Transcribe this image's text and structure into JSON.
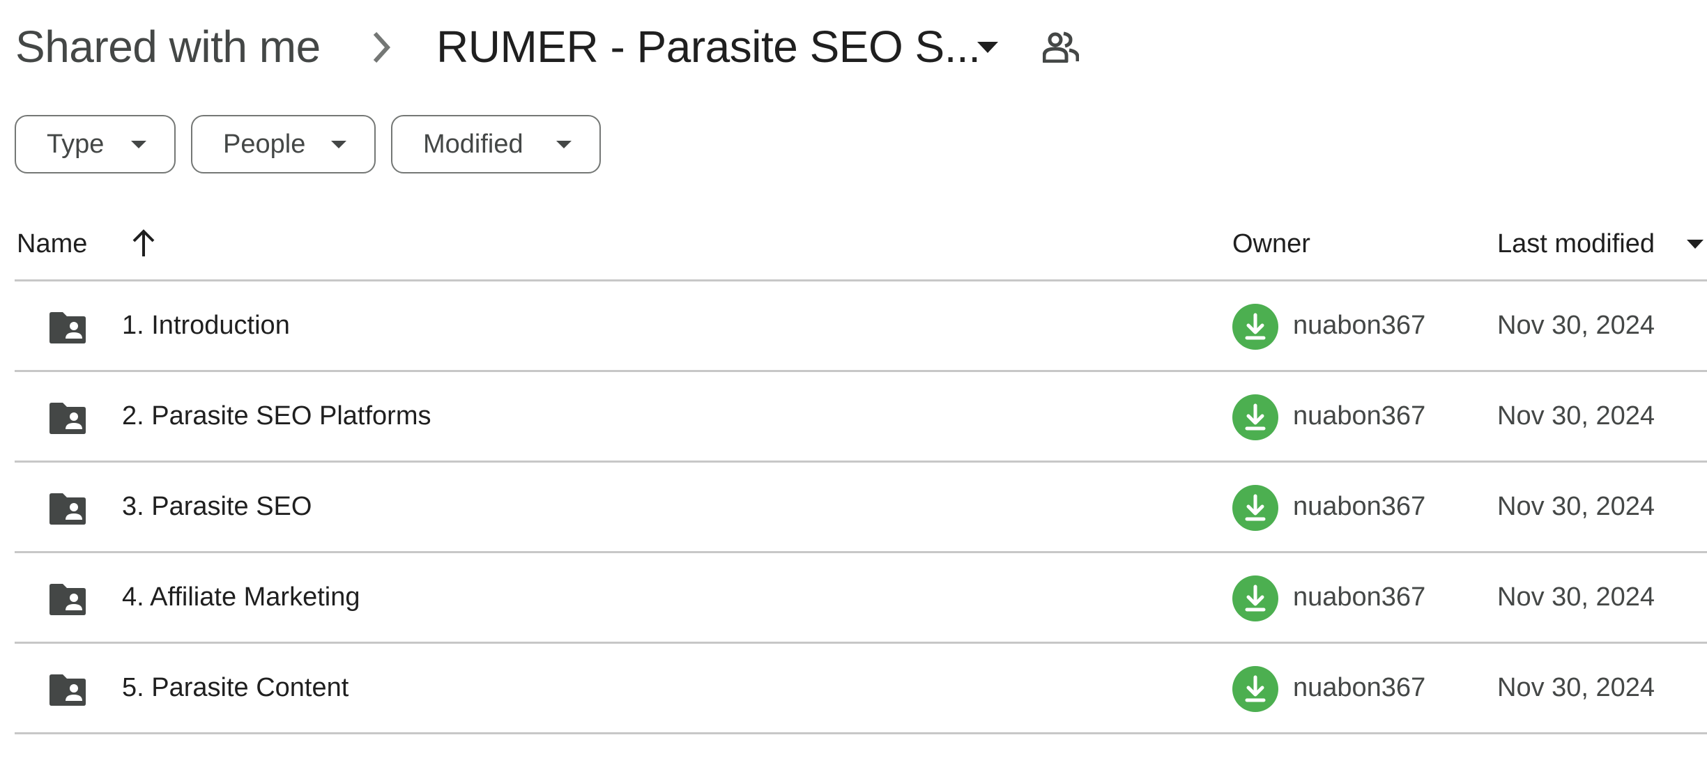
{
  "breadcrumb": {
    "root": "Shared with me",
    "separator_icon": "chevron-right-icon",
    "current": "RUMER - Parasite SEO S...",
    "dropdown_icon": "caret-down-icon",
    "shared_icon": "people-icon"
  },
  "filters": [
    {
      "label": "Type"
    },
    {
      "label": "People"
    },
    {
      "label": "Modified"
    }
  ],
  "table": {
    "columns": {
      "name": "Name",
      "owner": "Owner",
      "last_modified": "Last modified"
    },
    "sort": {
      "column": "Name",
      "direction": "ascending",
      "icon": "arrow-up-icon"
    },
    "rows": [
      {
        "name": "1. Introduction",
        "type_icon": "shared-folder-icon",
        "owner": "nuabon367",
        "owner_avatar_icon": "download-icon",
        "modified": "Nov 30, 2024"
      },
      {
        "name": "2. Parasite SEO Platforms",
        "type_icon": "shared-folder-icon",
        "owner": "nuabon367",
        "owner_avatar_icon": "download-icon",
        "modified": "Nov 30, 2024"
      },
      {
        "name": "3. Parasite SEO",
        "type_icon": "shared-folder-icon",
        "owner": "nuabon367",
        "owner_avatar_icon": "download-icon",
        "modified": "Nov 30, 2024"
      },
      {
        "name": "4. Affiliate Marketing",
        "type_icon": "shared-folder-icon",
        "owner": "nuabon367",
        "owner_avatar_icon": "download-icon",
        "modified": "Nov 30, 2024"
      },
      {
        "name": "5. Parasite Content",
        "type_icon": "shared-folder-icon",
        "owner": "nuabon367",
        "owner_avatar_icon": "download-icon",
        "modified": "Nov 30, 2024"
      }
    ]
  },
  "colors": {
    "avatar": "#4caf50",
    "folder_icon": "#444746",
    "divider": "#c7c7c7",
    "chip_border": "#747775"
  }
}
